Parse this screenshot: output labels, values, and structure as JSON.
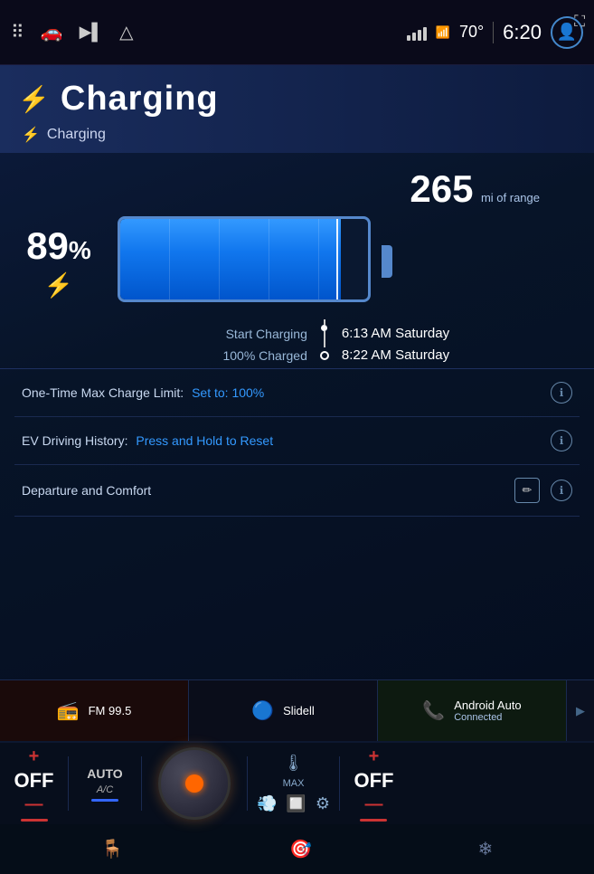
{
  "statusBar": {
    "temperature": "70°",
    "time": "6:20",
    "shareIcon": "⎋"
  },
  "navIcons": [
    "⋮⋮⋮",
    "🚗",
    "▶▶",
    "△"
  ],
  "page": {
    "title": "Charging",
    "subtitle": "Charging",
    "chargeLargeIcon": "⚡",
    "chargeSmallIcon": "⚡"
  },
  "battery": {
    "rangeValue": "265",
    "rangeUnit": "mi of range",
    "percentValue": "89",
    "percentSymbol": "%",
    "fillPercent": 89,
    "chargingIcon": "⚡"
  },
  "schedule": {
    "startLabel": "Start Charging",
    "startTime": "6:13 AM Saturday",
    "chargedLabel": "100% Charged",
    "chargedTime": "8:22 AM Saturday"
  },
  "settings": {
    "chargeLimit": {
      "label": "One-Time Max Charge Limit:",
      "value": "Set to: 100%"
    },
    "drivingHistory": {
      "label": "EV Driving History:",
      "value": "Press and Hold to Reset"
    },
    "departure": {
      "label": "Departure and Comfort"
    }
  },
  "mediaBar": {
    "tiles": [
      {
        "icon": "📻",
        "label": "FM  99.5",
        "color": "#cc3333"
      },
      {
        "icon": "🔵",
        "label": "Slidell",
        "color": "#3366ff"
      },
      {
        "icon": "📞",
        "label": "Android Auto",
        "sublabel": "Connected",
        "color": "#22cc44"
      }
    ]
  },
  "climate": {
    "leftTemp": "OFF",
    "leftPlus": "+",
    "leftMinus": "—",
    "leftLabel": "AUTO",
    "leftSublabel": "A/C",
    "rightTemp": "OFF",
    "rightPlus": "+",
    "rightMinus": "—",
    "maxLabel": "MAX"
  }
}
